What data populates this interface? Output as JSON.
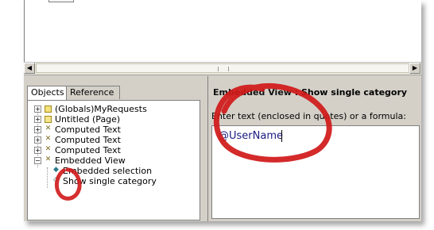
{
  "top_stub_text": "",
  "tabs": [
    {
      "label": "Objects",
      "active": true
    },
    {
      "label": "Reference",
      "active": false
    }
  ],
  "tree": [
    {
      "label": "(Globals)MyRequests",
      "expander": "+",
      "icon": "globals-icon"
    },
    {
      "label": "Untitled (Page)",
      "expander": "+",
      "icon": "page-icon"
    },
    {
      "label": "Computed Text",
      "expander": "+",
      "icon": "computed-text-icon"
    },
    {
      "label": "Computed Text",
      "expander": "+",
      "icon": "computed-text-icon"
    },
    {
      "label": "Computed Text",
      "expander": "+",
      "icon": "computed-text-icon"
    },
    {
      "label": "Embedded View",
      "expander": "−",
      "icon": "embedded-view-icon"
    },
    {
      "label": "Embedded selection",
      "icon": "diamond-filled-icon"
    },
    {
      "label": "Show single category",
      "icon": "diamond-outline-icon",
      "selected": true
    }
  ],
  "right": {
    "title_prefix": "Embedded View",
    "title_suffix": " : Show single category",
    "prompt": "Enter text (enclosed in quotes) or a formula:",
    "formula_value": "@UserName"
  },
  "colors": {
    "accent_red": "#d01818",
    "panel_bg": "#d4d0c8",
    "formula_text": "#1a1a80"
  }
}
